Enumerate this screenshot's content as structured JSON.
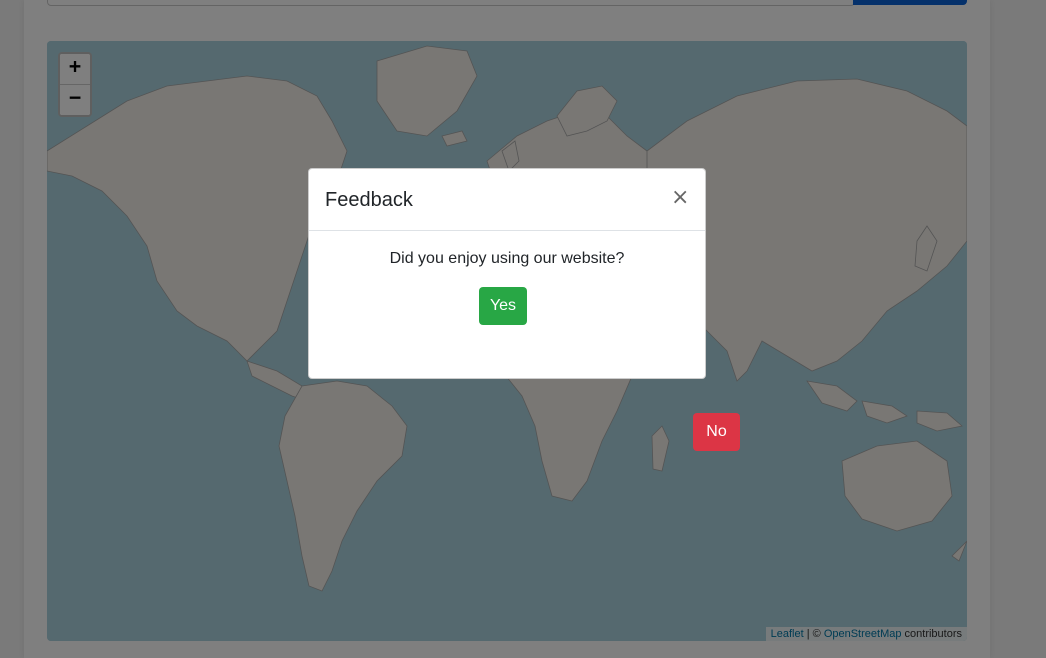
{
  "map": {
    "zoom_in_label": "+",
    "zoom_out_label": "−",
    "attribution": {
      "leaflet": "Leaflet",
      "separator": " | © ",
      "osm": "OpenStreetMap",
      "suffix": " contributors"
    },
    "colors": {
      "water": "#aad3df",
      "land": "#f2efe9",
      "border": "#9a9a9a"
    }
  },
  "modal": {
    "title": "Feedback",
    "close_symbol": "×",
    "question": "Did you enjoy using our website?",
    "yes_label": "Yes",
    "no_label": "No"
  },
  "colors": {
    "accent_yes": "#28a745",
    "accent_no": "#dc3545",
    "primary": "#0b62d6"
  }
}
